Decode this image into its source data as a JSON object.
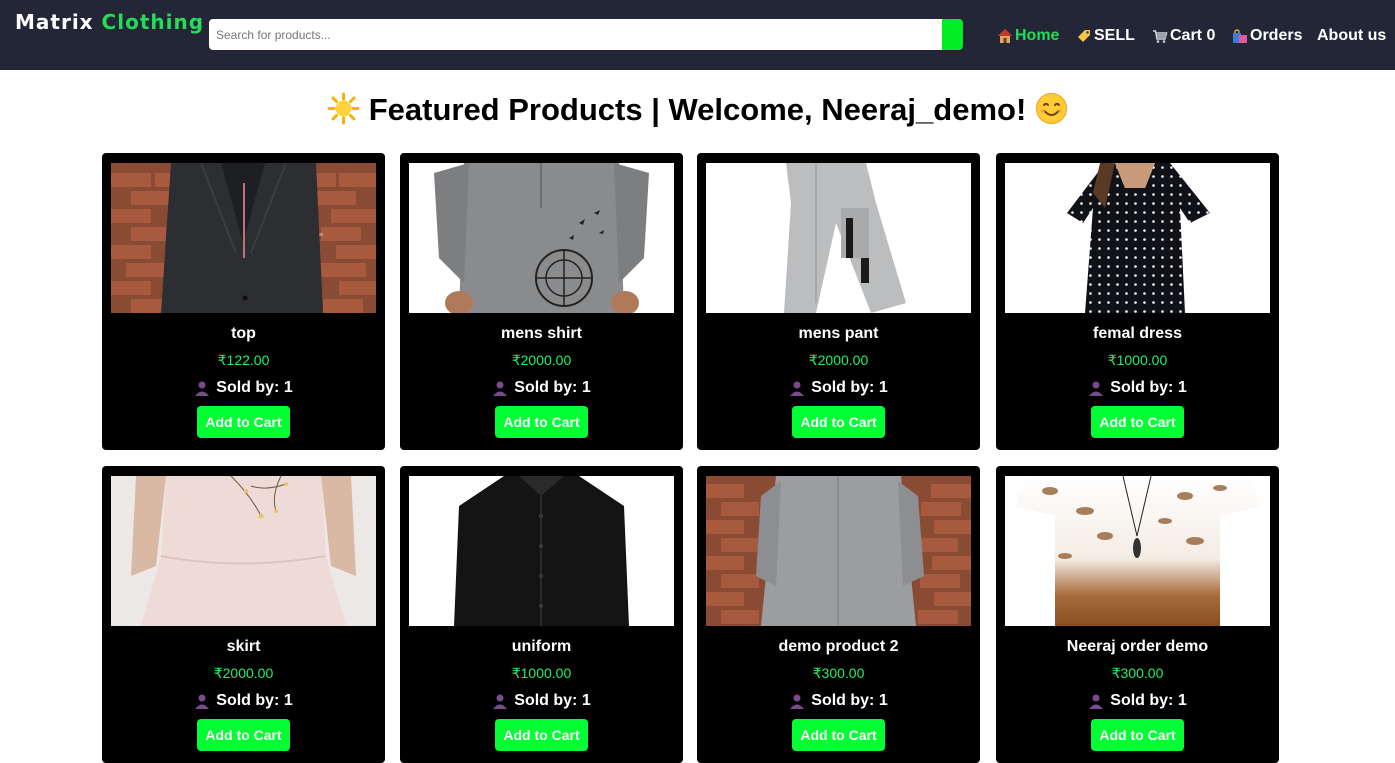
{
  "header": {
    "brand_first": "Matrix",
    "brand_second": "Clothing",
    "search_placeholder": "Search for products...",
    "nav": [
      {
        "label": "Home",
        "icon": "house-icon"
      },
      {
        "label": "SELL",
        "icon": "tag-icon"
      },
      {
        "label": "Cart 0",
        "icon": "cart-icon"
      },
      {
        "label": "Orders",
        "icon": "shopping-bags-icon"
      },
      {
        "label": "About us",
        "icon": ""
      }
    ]
  },
  "main": {
    "title": "Featured Products | Welcome, Neeraj_demo!"
  },
  "products": [
    {
      "name": "top",
      "price": "₹122.00",
      "sold_by": "Sold by: 1",
      "cta": "Add to Cart"
    },
    {
      "name": "mens shirt",
      "price": "₹2000.00",
      "sold_by": "Sold by: 1",
      "cta": "Add to Cart"
    },
    {
      "name": "mens pant",
      "price": "₹2000.00",
      "sold_by": "Sold by: 1",
      "cta": "Add to Cart"
    },
    {
      "name": "femal dress",
      "price": "₹1000.00",
      "sold_by": "Sold by: 1",
      "cta": "Add to Cart"
    },
    {
      "name": "skirt",
      "price": "₹2000.00",
      "sold_by": "Sold by: 1",
      "cta": "Add to Cart"
    },
    {
      "name": "uniform",
      "price": "₹1000.00",
      "sold_by": "Sold by: 1",
      "cta": "Add to Cart"
    },
    {
      "name": "demo product 2",
      "price": "₹300.00",
      "sold_by": "Sold by: 1",
      "cta": "Add to Cart"
    },
    {
      "name": "Neeraj order demo",
      "price": "₹300.00",
      "sold_by": "Sold by: 1",
      "cta": "Add to Cart"
    }
  ],
  "colors": {
    "navbar_bg": "#232636",
    "accent_green": "#00ff33",
    "price_green": "#22ee66",
    "card_bg": "#000000"
  }
}
